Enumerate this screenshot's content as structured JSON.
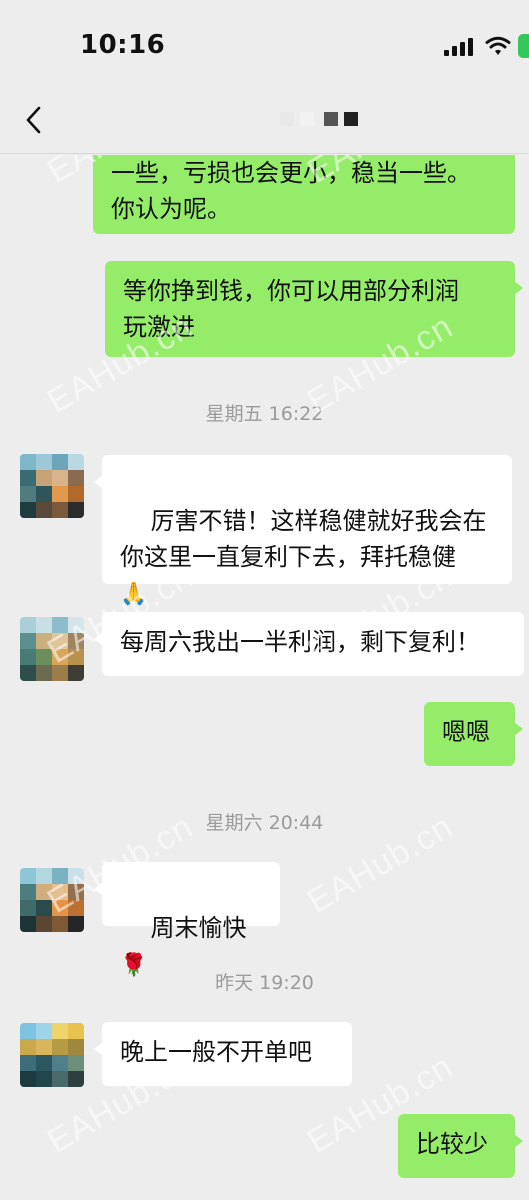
{
  "status_bar": {
    "time": "10:16"
  },
  "watermark": "EAHub.cn",
  "messages": [
    {
      "id": "m1",
      "side": "out",
      "text": "一些，亏损也会更小，稳当一些。\n你认为呢。"
    },
    {
      "id": "m2",
      "side": "out",
      "text": "等你挣到钱，你可以用部分利润\n玩激进"
    },
    {
      "id": "t1",
      "type": "timestamp",
      "text": "星期五 16:22"
    },
    {
      "id": "m3",
      "side": "in",
      "text": "厉害不错！这样稳健就好我会在\n你这里一直复利下去，拜托稳健",
      "emoji": "🙏"
    },
    {
      "id": "m4",
      "side": "in",
      "text": "每周六我出一半利润，剩下复利！"
    },
    {
      "id": "m5",
      "side": "out",
      "text": "嗯嗯"
    },
    {
      "id": "t2",
      "type": "timestamp",
      "text": "星期六 20:44"
    },
    {
      "id": "m6",
      "side": "in",
      "text": "周末愉快",
      "emoji": "🌹"
    },
    {
      "id": "t3",
      "type": "timestamp",
      "text": "昨天 19:20"
    },
    {
      "id": "m7",
      "side": "in",
      "text": "晚上一般不开单吧"
    },
    {
      "id": "m8",
      "side": "out",
      "text": "比较少"
    }
  ],
  "colors": {
    "outgoing_bubble": "#95ec69",
    "incoming_bubble": "#ffffff",
    "background": "#ededed",
    "timestamp": "#9b9b9b"
  },
  "icons": {
    "back": "chevron-left-icon",
    "signal": "cellular-signal-icon",
    "wifi": "wifi-icon",
    "battery": "battery-icon"
  }
}
